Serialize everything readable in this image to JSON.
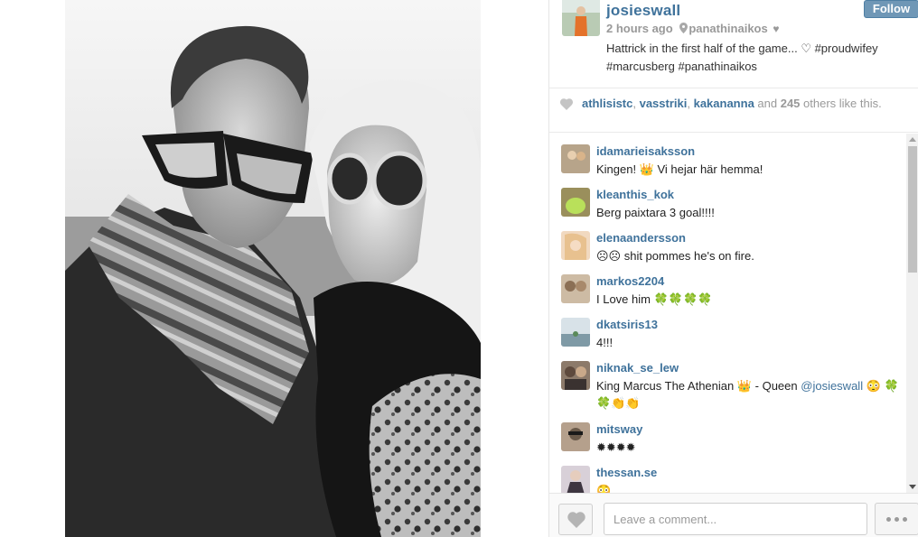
{
  "post": {
    "username": "josieswall",
    "follow_label": "Follow",
    "time": "2 hours ago",
    "location": "panathinaikos",
    "location_suffix": "♥",
    "caption": "Hattrick in the first half of the game... ♡ #proudwifey #marcusberg #panathinaikos"
  },
  "likes": {
    "users": [
      "athlisistc",
      "vasstriki",
      "kakananna"
    ],
    "sep1": ", ",
    "sep2": ", ",
    "and_text": " and ",
    "count": "245",
    "suffix": " others like this."
  },
  "comments": [
    {
      "user": "idamarieisaksson",
      "text": "Kingen! 👑 Vi hejar här hemma!",
      "avatar": "#b7a48a"
    },
    {
      "user": "kleanthis_kok",
      "text": "Berg paixtara 3 goal!!!!",
      "avatar": "#9a8f5c"
    },
    {
      "user": "elenaandersson",
      "text": "☹☹ shit pommes he's on fire.",
      "avatar": "#d8b58a"
    },
    {
      "user": "markos2204",
      "text": "I Love him 🍀🍀🍀🍀",
      "avatar": "#8b6f55"
    },
    {
      "user": "dkatsiris13",
      "text": "4!!!",
      "avatar": "#7f9aa6"
    },
    {
      "user": "niknak_se_lew",
      "text_pre": "King Marcus The Athenian 👑 - Queen ",
      "mention": "@josieswall",
      "text_post": " 😳 🍀🍀👏👏",
      "avatar": "#5e4a3d"
    },
    {
      "user": "mitsway",
      "text": "✹✹✹✹",
      "avatar": "#6a5a4a"
    },
    {
      "user": "thessan.se",
      "text": "😳",
      "avatar": "#3d3540"
    }
  ],
  "footer": {
    "comment_placeholder": "Leave a comment..."
  },
  "colors": {
    "link": "#3f729b",
    "follow_bg": "#6f97b6"
  },
  "icons": [
    "location-pin-icon",
    "heart-icon",
    "like-heart-icon",
    "more-options-icon"
  ]
}
